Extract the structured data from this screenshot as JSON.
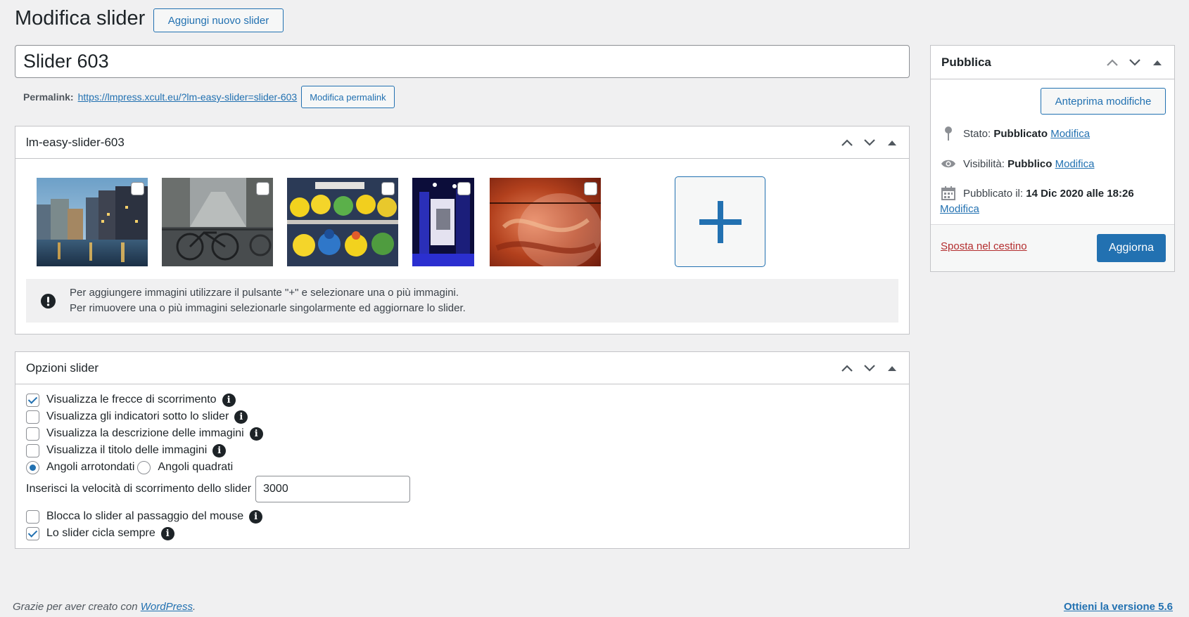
{
  "header": {
    "title": "Modifica slider",
    "add_new_label": "Aggiungi nuovo slider"
  },
  "post": {
    "title_value": "Slider 603",
    "permalink_label": "Permalink:",
    "permalink_url": "https://lmpress.xcult.eu/?lm-easy-slider=slider-603",
    "edit_permalink_label": "Modifica permalink"
  },
  "slider_box": {
    "title": "lm-easy-slider-603",
    "images": [
      {
        "name": "amsterdam-canal-night",
        "selected": false
      },
      {
        "name": "bicycle-canal-bridge",
        "selected": false
      },
      {
        "name": "rubber-ducks-shelf",
        "selected": false
      },
      {
        "name": "blue-lit-corridor",
        "selected": false
      },
      {
        "name": "red-abstract-texture",
        "selected": false
      }
    ],
    "notice_line1": "Per aggiungere immagini utilizzare il pulsante \"+\" e selezionare una o più immagini.",
    "notice_line2": "Per rimuovere una o più immagini selezionarle singolarmente ed aggiornare lo slider."
  },
  "options_box": {
    "title": "Opzioni slider",
    "show_arrows": {
      "label": "Visualizza le frecce di scorrimento",
      "checked": true
    },
    "show_indicators": {
      "label": "Visualizza gli indicatori sotto lo slider",
      "checked": false
    },
    "show_description": {
      "label": "Visualizza la descrizione delle immagini",
      "checked": false
    },
    "show_title": {
      "label": "Visualizza il titolo delle immagini",
      "checked": false
    },
    "corners_rounded": "Angoli arrotondati",
    "corners_square": "Angoli quadrati",
    "corners_selected": "rounded",
    "speed_label": "Inserisci la velocità di scorrimento dello slider",
    "speed_value": "3000",
    "pause_hover": {
      "label": "Blocca lo slider al passaggio del mouse",
      "checked": false
    },
    "loop": {
      "label": "Lo slider cicla sempre",
      "checked": true
    }
  },
  "publish_box": {
    "title": "Pubblica",
    "preview_label": "Anteprima modifiche",
    "status_label": "Stato:",
    "status_value": "Pubblicato",
    "visibility_label": "Visibilità:",
    "visibility_value": "Pubblico",
    "published_label": "Pubblicato il:",
    "published_value": "14 Dic 2020 alle 18:26",
    "edit_label": "Modifica",
    "trash_label": "Sposta nel cestino",
    "update_label": "Aggiorna"
  },
  "footer": {
    "thanks_prefix": "Grazie per aver creato con",
    "wordpress_link": "WordPress",
    "thanks_suffix": ".",
    "version_link": "Ottieni la versione 5.6"
  },
  "colors": {
    "accent": "#2271b1",
    "danger": "#b32d2e",
    "background": "#f0f0f1"
  }
}
